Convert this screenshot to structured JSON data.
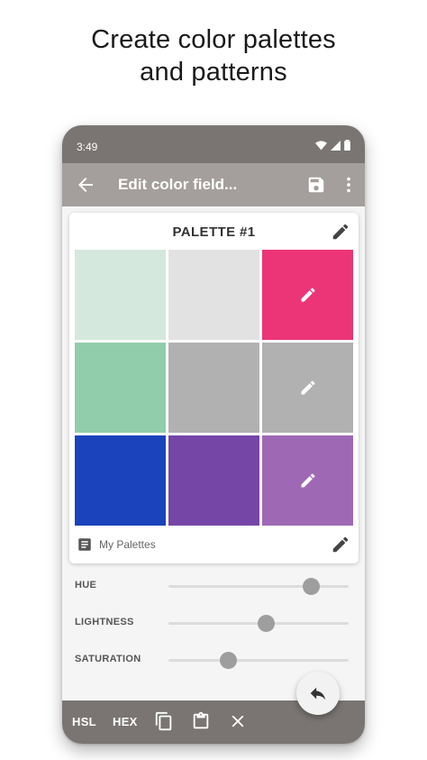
{
  "headline": {
    "line1": "Create color palettes",
    "line2": "and patterns"
  },
  "status_bar": {
    "time": "3:49"
  },
  "app_bar": {
    "title": "Edit color field..."
  },
  "palette": {
    "title": "PALETTE #1",
    "swatches": [
      {
        "color": "#d5e8dd",
        "edit_icon": false
      },
      {
        "color": "#e2e2e2",
        "edit_icon": false
      },
      {
        "color": "#ec3577",
        "edit_icon": true
      },
      {
        "color": "#91cdaa",
        "edit_icon": false
      },
      {
        "color": "#b1b1b1",
        "edit_icon": false
      },
      {
        "color": "#b1b1b1",
        "edit_icon": true
      },
      {
        "color": "#1b43bb",
        "edit_icon": false
      },
      {
        "color": "#7646a7",
        "edit_icon": false
      },
      {
        "color": "#9f68b4",
        "edit_icon": true
      }
    ],
    "collection_label": "My Palettes"
  },
  "sliders": [
    {
      "label": "HUE",
      "value": 0.79
    },
    {
      "label": "LIGHTNESS",
      "value": 0.54
    },
    {
      "label": "SATURATION",
      "value": 0.33
    }
  ],
  "bottom_bar": {
    "hsl_label": "HSL",
    "hex_label": "HEX"
  },
  "icons": {
    "back": "arrow-back-icon",
    "save": "save-icon",
    "more": "more-vert-icon",
    "edit": "pencil-icon",
    "notes": "notes-icon",
    "copy": "copy-icon",
    "paste": "clipboard-icon",
    "close": "close-icon",
    "undo": "reply-icon"
  },
  "colors": {
    "status_bar": "#7a7573",
    "app_bar": "#a49e9c",
    "bottom_bar": "#7a7573",
    "slider_thumb": "#9e9e9e"
  }
}
